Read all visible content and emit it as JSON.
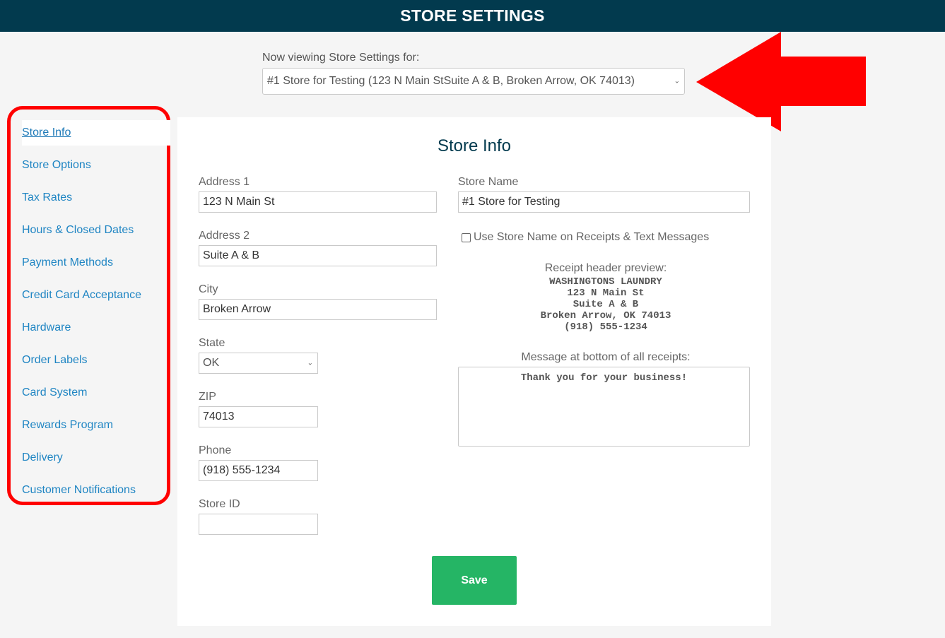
{
  "header": {
    "title": "STORE SETTINGS"
  },
  "store_selector": {
    "label": "Now viewing Store Settings for:",
    "value": "#1 Store for Testing (123 N Main StSuite A & B, Broken Arrow, OK 74013)"
  },
  "sidebar": {
    "items": [
      {
        "label": "Store Info",
        "active": true
      },
      {
        "label": "Store Options"
      },
      {
        "label": "Tax Rates"
      },
      {
        "label": "Hours & Closed Dates"
      },
      {
        "label": "Payment Methods"
      },
      {
        "label": "Credit Card Acceptance"
      },
      {
        "label": "Hardware"
      },
      {
        "label": "Order Labels"
      },
      {
        "label": "Card System"
      },
      {
        "label": "Rewards Program"
      },
      {
        "label": "Delivery"
      },
      {
        "label": "Customer Notifications"
      }
    ]
  },
  "form": {
    "title": "Store Info",
    "address1": {
      "label": "Address 1",
      "value": "123 N Main St"
    },
    "address2": {
      "label": "Address 2",
      "value": "Suite A & B"
    },
    "city": {
      "label": "City",
      "value": "Broken Arrow"
    },
    "state": {
      "label": "State",
      "value": "OK"
    },
    "zip": {
      "label": "ZIP",
      "value": "74013"
    },
    "phone": {
      "label": "Phone",
      "value": "(918) 555-1234"
    },
    "store_id": {
      "label": "Store ID",
      "value": ""
    },
    "store_name": {
      "label": "Store Name",
      "value": "#1 Store for Testing"
    },
    "use_store_name_checkbox": {
      "label": "Use Store Name on Receipts & Text Messages",
      "checked": false
    },
    "receipt_preview": {
      "label": "Receipt header preview:",
      "lines": [
        "WASHINGTONS LAUNDRY",
        "123 N Main St",
        "Suite A & B",
        "Broken Arrow, OK 74013",
        "(918) 555-1234"
      ]
    },
    "bottom_message": {
      "label": "Message at bottom of all receipts:",
      "value": "Thank you for your business!"
    },
    "save_label": "Save"
  },
  "colors": {
    "header_bg": "#023a4e",
    "link": "#1f85c3",
    "save_button": "#25b565",
    "annotation_red": "#ff0000"
  }
}
